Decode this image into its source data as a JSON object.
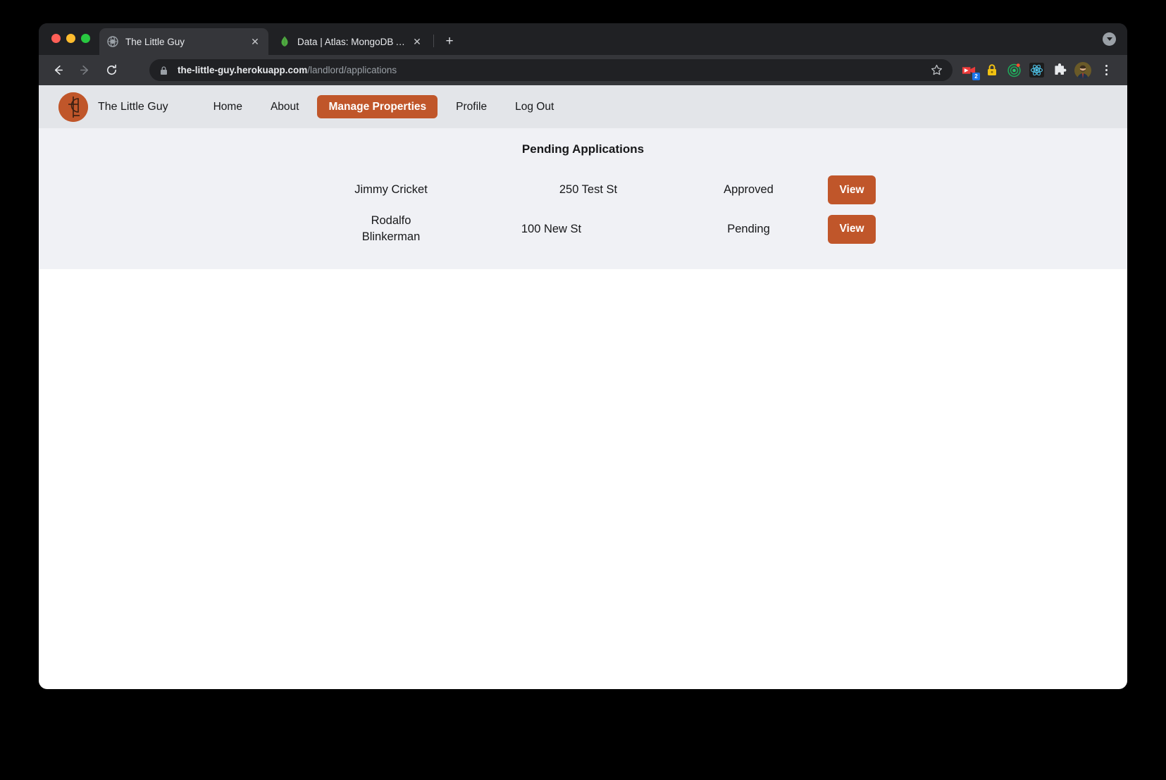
{
  "browser": {
    "traffic_lights": [
      "close",
      "minimize",
      "zoom"
    ],
    "tabs": [
      {
        "title": "The Little Guy",
        "favicon": "globe-icon",
        "active": true,
        "close_label": "✕"
      },
      {
        "title": "Data | Atlas: MongoDB Atlas",
        "favicon": "mongodb-leaf-icon",
        "active": false,
        "close_label": "✕"
      }
    ],
    "new_tab_label": "+",
    "tab_search_icon": "caret-down-icon",
    "toolbar": {
      "back_icon": "arrow-left-icon",
      "forward_icon": "arrow-right-icon",
      "reload_icon": "reload-icon",
      "security_icon": "lock-icon",
      "url_domain": "the-little-guy.herokuapp.com",
      "url_path": "/landlord/applications",
      "bookmark_icon": "star-icon",
      "extensions": [
        {
          "name": "screen-recorder-extension-icon",
          "badge": "2"
        },
        {
          "name": "password-manager-lock-icon",
          "badge": ""
        },
        {
          "name": "target-tracker-extension-icon",
          "badge": ""
        },
        {
          "name": "react-devtools-icon",
          "badge": ""
        },
        {
          "name": "extensions-puzzle-icon",
          "badge": ""
        }
      ],
      "avatar_icon": "profile-avatar",
      "menu_icon": "kebab-menu-icon"
    }
  },
  "site": {
    "brand": {
      "logo_icon": "the-little-guy-logo",
      "name": "The Little Guy"
    },
    "nav": [
      {
        "label": "Home",
        "active": false
      },
      {
        "label": "About",
        "active": false
      },
      {
        "label": "Manage Properties",
        "active": true
      },
      {
        "label": "Profile",
        "active": false
      },
      {
        "label": "Log Out",
        "active": false
      }
    ],
    "main": {
      "title": "Pending Applications",
      "applications": [
        {
          "applicant": "Jimmy Cricket",
          "address": "250 Test St",
          "status": "Approved",
          "action_label": "View"
        },
        {
          "applicant": "Rodalfo Blinkerman",
          "address": "100 New St",
          "status": "Pending",
          "action_label": "View"
        }
      ]
    }
  },
  "colors": {
    "brand_orange": "#c0562a",
    "nav_bg": "#e3e5e9",
    "content_bg": "#f0f1f5",
    "chrome_dark": "#202124",
    "toolbar_dark": "#35363a"
  }
}
